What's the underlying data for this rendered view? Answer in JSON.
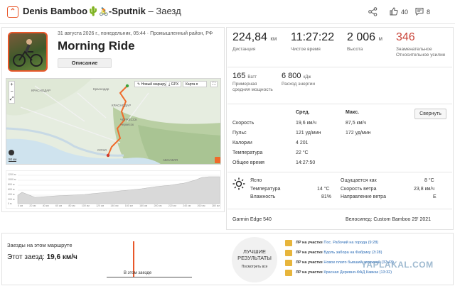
{
  "header": {
    "logo_icon": "activity-logo-icon",
    "title_name": "Denis Bamboo",
    "title_rest": "-Sputnik",
    "title_suffix": "– Заезд",
    "likes": "40",
    "comments": "8"
  },
  "activity": {
    "date": "31 августа 2026 г., понедельник, 05:44 · Промышленный район, РФ",
    "name": "Morning Ride",
    "description_button": "Описание"
  },
  "map": {
    "new_route": "Новый маршрут",
    "gpx": "GPX",
    "map_mode": "Карта",
    "cities": [
      "КРАСНОДАР",
      "Краснодар",
      "КРАСНОДАР",
      "ЧЕРКЕССК",
      "Черкесск",
      "СОЧИ",
      "АБХАЗИЯ"
    ],
    "scale": "50 км"
  },
  "elevation": {
    "y_labels": [
      "1200 м",
      "1000 м",
      "800 м",
      "600 м",
      "400 м",
      "200 м",
      "0 м"
    ],
    "x_labels": [
      "0 км",
      "20 км",
      "40 км",
      "60 км",
      "80 км",
      "100 км",
      "120 км",
      "140 км",
      "160 км",
      "180 км",
      "200 км",
      "220 км",
      "240 км",
      "260 км",
      "280 км"
    ]
  },
  "stats": {
    "distance": {
      "value": "224,84",
      "unit": "км",
      "label": "Дистанция"
    },
    "moving_time": {
      "value": "11:27:22",
      "label": "Чистое время"
    },
    "elevation": {
      "value": "2 006",
      "unit": "м",
      "label": "Высота"
    },
    "relative_effort": {
      "value": "346",
      "label": "Знаменательное Относительное усилие"
    },
    "power": {
      "value": "165",
      "unit": "Ватт",
      "label": "Примерная средняя мощность"
    },
    "energy": {
      "value": "6 800",
      "unit": "кДж",
      "label": "Расход энергии"
    }
  },
  "table": {
    "col_avg": "Сред.",
    "col_max": "Макс.",
    "collapse_button": "Свернуть",
    "rows": [
      {
        "label": "Скорость",
        "avg": "19,6 км/ч",
        "max": "87,5 км/ч"
      },
      {
        "label": "Пульс",
        "avg": "121 уд/мин",
        "max": "172 уд/мин"
      },
      {
        "label": "Калории",
        "avg": "4 201",
        "max": ""
      },
      {
        "label": "Температура",
        "avg": "22 °C",
        "max": ""
      },
      {
        "label": "Общее время",
        "avg": "14:27:50",
        "max": ""
      }
    ]
  },
  "weather": {
    "icon": "sun-icon",
    "condition": "Ясно",
    "temp_label": "Температура",
    "temp_value": "14 °C",
    "humidity_label": "Влажность",
    "humidity_value": "81%",
    "feels_label": "Ощущается как",
    "feels_value": "8 °C",
    "wind_label": "Скорость ветра",
    "wind_value": "23,8 км/ч",
    "dir_label": "Направление ветра",
    "dir_value": "E"
  },
  "gear": {
    "device": "Garmin Edge 540",
    "bike_label": "Велосипед:",
    "bike": "Custom Bamboo 29' 2021"
  },
  "segment": {
    "title": "Заезды на этом маршруте",
    "this_ride_label": "Этот заезд:",
    "this_ride_value": "19,6 км/ч",
    "marker_label": "В этом заезде"
  },
  "best": {
    "title": "ЛУЧШИЕ РЕЗУЛЬТАТЫ",
    "link": "Посмотреть все",
    "items": [
      {
        "prefix": "ЛР на участке",
        "name": "Пос. Рабочий на города (9:28)"
      },
      {
        "prefix": "ЛР на участке",
        "name": "Вдоль забора на Фабрику (3:28)"
      },
      {
        "prefix": "ЛР на участке",
        "name": "Новое плато бывший затяжной (37:43)"
      },
      {
        "prefix": "ЛР на участке",
        "name": "Красная Деревня-ФАД Кавказ (13:32)"
      }
    ]
  },
  "watermark": "YAPLAKAL.COM",
  "colors": {
    "accent": "#e8572a",
    "effort": "#c9453a",
    "link": "#2a6bb5"
  }
}
